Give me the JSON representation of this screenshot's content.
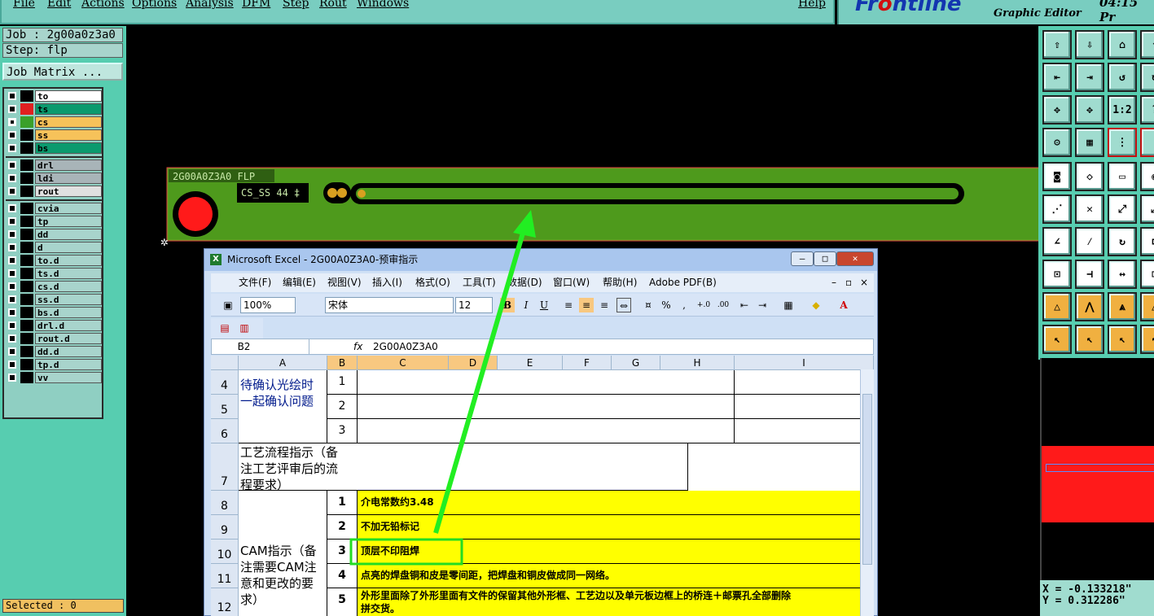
{
  "menu": [
    "File",
    "Edit",
    "Actions",
    "Options",
    "Analysis",
    "DFM",
    "Step",
    "Rout",
    "Windows"
  ],
  "help": "Help",
  "brand": {
    "logo_a": "Fr",
    "logo_b": "o",
    "logo_c": "ntline",
    "sub": "Graphic Editor",
    "clock": "04:15 Pr"
  },
  "job": "Job : 2g00a0z3a0",
  "step": "Step: flp",
  "job_matrix": "Job Matrix ...",
  "layers": [
    {
      "name": "to",
      "sw": "#000",
      "bg": "#ffffff"
    },
    {
      "name": "ts",
      "sw": "#e02020",
      "bg": "#0b9a6e"
    },
    {
      "name": "cs",
      "sw": "#3aa02a",
      "bg": "#f6c25a",
      "active": true
    },
    {
      "name": "ss",
      "sw": "#000",
      "bg": "#f6c25a"
    },
    {
      "name": "bs",
      "sw": "#000",
      "bg": "#0b9a6e"
    }
  ],
  "layers2": [
    {
      "name": "drl",
      "bg": "#a8b4b8"
    },
    {
      "name": "ldi",
      "bg": "#a8b4b8"
    },
    {
      "name": "rout",
      "bg": "#e0e0e0"
    }
  ],
  "layers3": [
    "cvia",
    "tp",
    "dd",
    "d",
    "to.d",
    "ts.d",
    "cs.d",
    "ss.d",
    "bs.d",
    "drl.d",
    "rout.d",
    "dd.d",
    "tp.d",
    "vv"
  ],
  "selected": "Selected : 0",
  "board": {
    "label1": "2G00A0Z3A0 FLP",
    "label2": "CS_SS 44 ‡"
  },
  "coords": {
    "x": "X = -0.133218\"",
    "y": "Y = 0.312286\""
  },
  "excel": {
    "title": "Microsoft Excel - 2G00A0Z3A0-预审指示",
    "menu": [
      "文件(F)",
      "编辑(E)",
      "视图(V)",
      "插入(I)",
      "格式(O)",
      "工具(T)",
      "数据(D)",
      "窗口(W)",
      "帮助(H)",
      "Adobe PDF(B)"
    ],
    "zoom": "100%",
    "font": "宋体",
    "size": "12",
    "namebox": "B2",
    "formula": "2G00A0Z3A0",
    "cols": [
      "A",
      "B",
      "C",
      "D",
      "E",
      "F",
      "G",
      "H",
      "I"
    ],
    "rows": [
      "4",
      "5",
      "6",
      "7",
      "8",
      "9",
      "10",
      "11",
      "12"
    ],
    "a_confirm": "待确认光绘时一起确认问题",
    "a_process": "工艺流程指示（备注工艺评审后的流程要求）",
    "a_cam": "CAM指示（备注需要CAM注意和更改的要求）",
    "b_nums": [
      "1",
      "2",
      "3",
      "1",
      "2",
      "3",
      "4",
      "5"
    ],
    "cam_items": [
      "介电常数约3.48",
      "不加无铅标记",
      "顶层不印阻焊",
      "点亮的焊盘铜和皮是零间距，把焊盘和铜皮做成同一网络。",
      "外形里面除了外形里面有文件的保留其他外形框、工艺边以及单元板边框上的桥连＋邮票孔全部删除",
      "拼交货。"
    ]
  }
}
